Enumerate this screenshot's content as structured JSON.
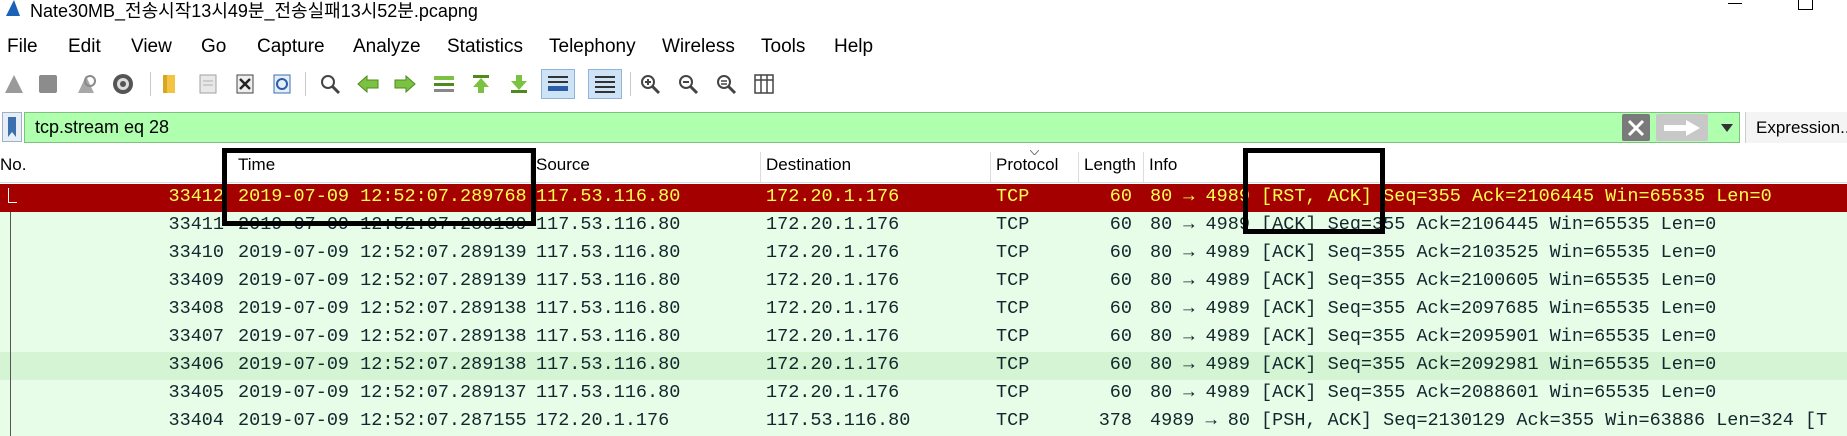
{
  "window": {
    "title": "Nate30MB_전송시작13시49분_전송실패13시52분.pcapng"
  },
  "menu": [
    "File",
    "Edit",
    "View",
    "Go",
    "Capture",
    "Analyze",
    "Statistics",
    "Telephony",
    "Wireless",
    "Tools",
    "Help"
  ],
  "toolbar": {
    "icons": [
      "start-capture-icon",
      "stop-capture-icon",
      "restart-capture-icon",
      "capture-options-icon",
      "open-file-icon",
      "save-file-icon",
      "close-file-icon",
      "reload-file-icon",
      "find-packet-icon",
      "go-back-icon",
      "go-forward-icon",
      "go-to-packet-icon",
      "go-first-icon",
      "go-last-icon",
      "auto-scroll-icon",
      "colorize-icon",
      "zoom-in-icon",
      "zoom-out-icon",
      "normal-size-icon",
      "resize-columns-icon"
    ]
  },
  "filter": {
    "value": "tcp.stream eq 28",
    "expression_label": "Expression..."
  },
  "columns": [
    "No.",
    "Time",
    "Source",
    "Destination",
    "Protocol",
    "Length",
    "Info"
  ],
  "colors": {
    "selected_bg": "#a40000",
    "selected_fg": "#ffff50",
    "row_bg": "#e7fde7",
    "row_alt_bg": "#d4f4d4",
    "filter_bg": "#afffaf"
  },
  "rows": [
    {
      "no": "33412",
      "time": "2019-07-09 12:52:07.289768",
      "source": "117.53.116.80",
      "destination": "172.20.1.176",
      "protocol": "TCP",
      "length": "60",
      "info": "80 → 4989 [RST, ACK] Seq=355 Ack=2106445 Win=65535 Len=0"
    },
    {
      "no": "33411",
      "time": "2019-07-09 12:52:07.289139",
      "source": "117.53.116.80",
      "destination": "172.20.1.176",
      "protocol": "TCP",
      "length": "60",
      "info": "80 → 4989 [ACK] Seq=355 Ack=2106445 Win=65535 Len=0"
    },
    {
      "no": "33410",
      "time": "2019-07-09 12:52:07.289139",
      "source": "117.53.116.80",
      "destination": "172.20.1.176",
      "protocol": "TCP",
      "length": "60",
      "info": "80 → 4989 [ACK] Seq=355 Ack=2103525 Win=65535 Len=0"
    },
    {
      "no": "33409",
      "time": "2019-07-09 12:52:07.289139",
      "source": "117.53.116.80",
      "destination": "172.20.1.176",
      "protocol": "TCP",
      "length": "60",
      "info": "80 → 4989 [ACK] Seq=355 Ack=2100605 Win=65535 Len=0"
    },
    {
      "no": "33408",
      "time": "2019-07-09 12:52:07.289138",
      "source": "117.53.116.80",
      "destination": "172.20.1.176",
      "protocol": "TCP",
      "length": "60",
      "info": "80 → 4989 [ACK] Seq=355 Ack=2097685 Win=65535 Len=0"
    },
    {
      "no": "33407",
      "time": "2019-07-09 12:52:07.289138",
      "source": "117.53.116.80",
      "destination": "172.20.1.176",
      "protocol": "TCP",
      "length": "60",
      "info": "80 → 4989 [ACK] Seq=355 Ack=2095901 Win=65535 Len=0"
    },
    {
      "no": "33406",
      "time": "2019-07-09 12:52:07.289138",
      "source": "117.53.116.80",
      "destination": "172.20.1.176",
      "protocol": "TCP",
      "length": "60",
      "info": "80 → 4989 [ACK] Seq=355 Ack=2092981 Win=65535 Len=0"
    },
    {
      "no": "33405",
      "time": "2019-07-09 12:52:07.289137",
      "source": "117.53.116.80",
      "destination": "172.20.1.176",
      "protocol": "TCP",
      "length": "60",
      "info": "80 → 4989 [ACK] Seq=355 Ack=2088601 Win=65535 Len=0"
    },
    {
      "no": "33404",
      "time": "2019-07-09 12:52:07.287155",
      "source": "172.20.1.176",
      "destination": "117.53.116.80",
      "protocol": "TCP",
      "length": "378",
      "info": "4989 → 80 [PSH, ACK] Seq=2130129 Ack=355 Win=63886 Len=324 [T"
    }
  ]
}
